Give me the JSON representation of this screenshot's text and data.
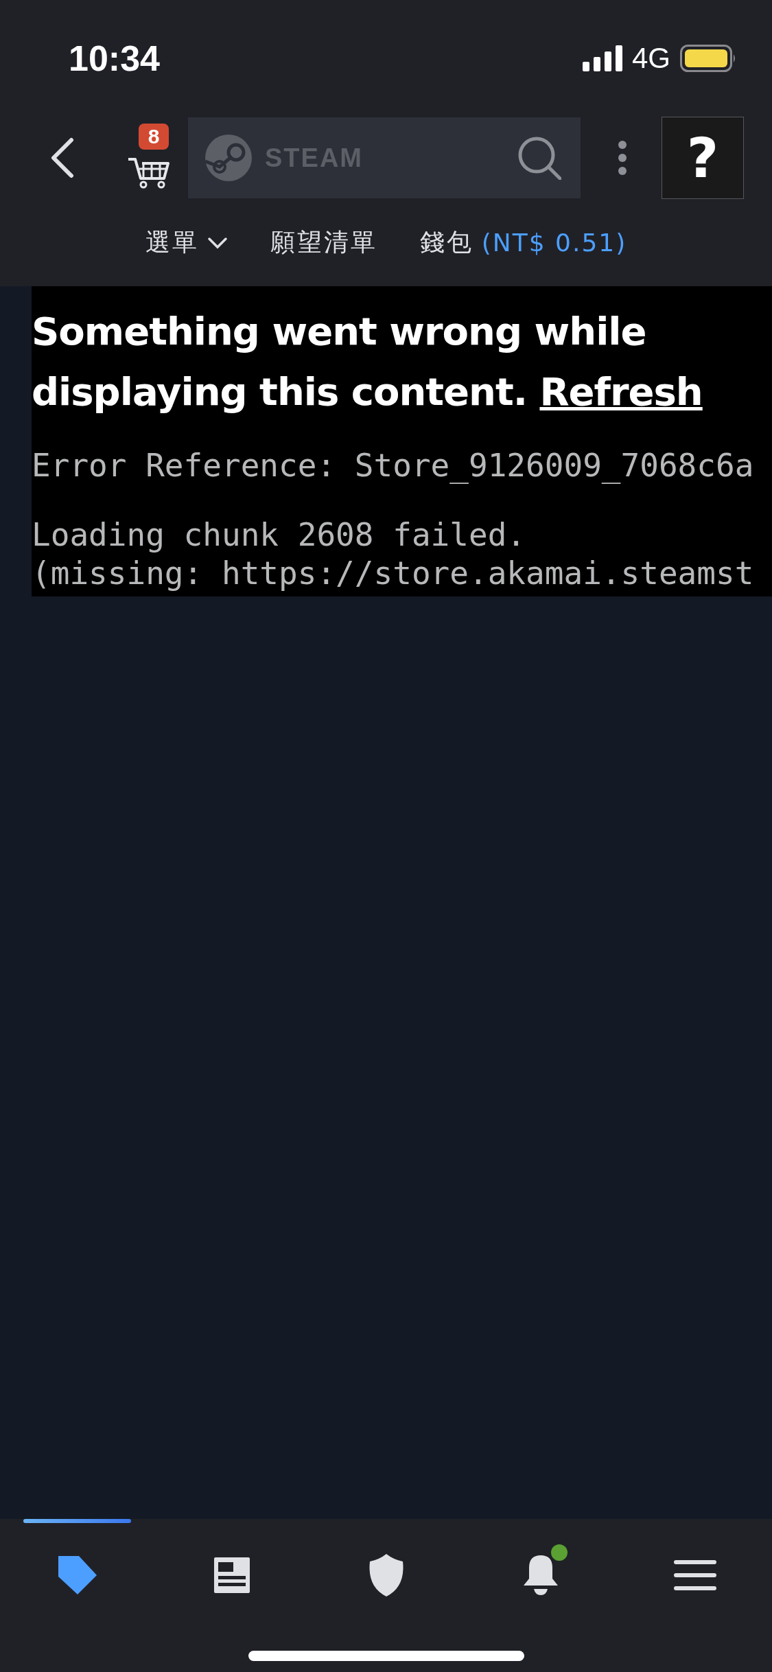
{
  "status_bar": {
    "time": "10:34",
    "network": "4G"
  },
  "header": {
    "cart_count": "8",
    "search_logo_text": "STEAM",
    "help_label": "?"
  },
  "nav": [
    {
      "kind": "dropdown",
      "label": "選單"
    },
    {
      "kind": "link",
      "label": "願望清單"
    },
    {
      "kind": "wallet",
      "label": "錢包",
      "amount": "(NT$ 0.51)"
    }
  ],
  "error": {
    "message": "Something went wrong while displaying this content.",
    "action": "Refresh",
    "reference": "Error Reference: Store_9126009_7068c6a",
    "details": [
      "Loading chunk 2608 failed.",
      "(missing: https://store.akamai.steamst"
    ]
  },
  "tabs": [
    {
      "kind": "tag",
      "selected": true,
      "notification": false
    },
    {
      "kind": "news",
      "selected": false,
      "notification": false
    },
    {
      "kind": "shield",
      "selected": false,
      "notification": false
    },
    {
      "kind": "bell",
      "selected": false,
      "notification": true
    },
    {
      "kind": "menu",
      "selected": false,
      "notification": false
    }
  ]
}
